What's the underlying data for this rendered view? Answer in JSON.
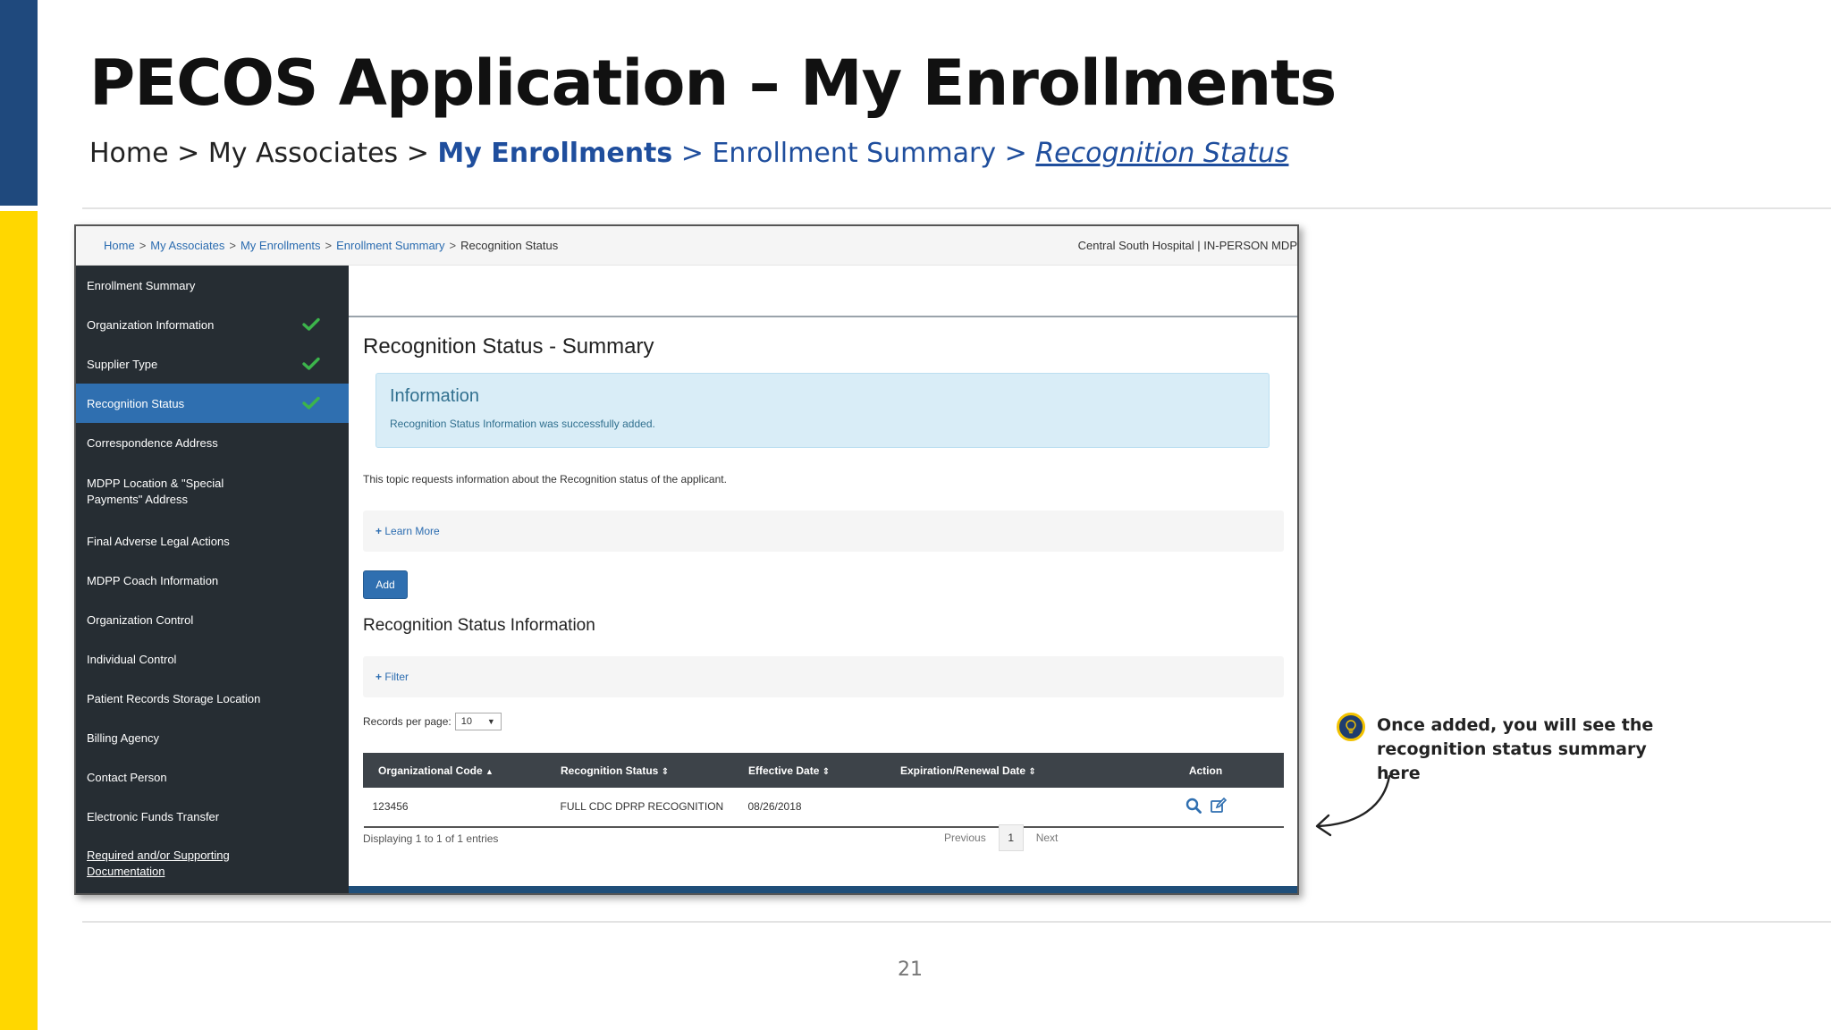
{
  "slide": {
    "title": "PECOS Application – My Enrollments",
    "breadcrumb": {
      "home": "Home",
      "sep": " > ",
      "my_associates": "My Associates",
      "my_enrollments": "My Enrollments",
      "enrollment_summary": "Enrollment Summary",
      "recognition_status": "Recognition Status"
    },
    "callout": "Once added, you will see the recognition status summary here",
    "page_number": "21",
    "colors": {
      "blue_bar": "#1f497d",
      "yellow_bar": "#ffd700"
    }
  },
  "app": {
    "breadcrumb": {
      "home": "Home",
      "my_associates": "My Associates",
      "my_enrollments": "My Enrollments",
      "enrollment_summary": "Enrollment Summary",
      "current": "Recognition Status",
      "sep": ">"
    },
    "facility": "Central South Hospital |  IN-PERSON MDP",
    "sidebar": {
      "items": [
        {
          "label": "Enrollment Summary"
        },
        {
          "label": "Organization Information",
          "check": true
        },
        {
          "label": "Supplier Type",
          "check": true
        },
        {
          "label": "Recognition Status",
          "check": true,
          "active": true
        },
        {
          "label": "Correspondence Address"
        },
        {
          "label": "MDPP Location & \"Special Payments\" Address"
        },
        {
          "label": "Final Adverse Legal Actions"
        },
        {
          "label": "MDPP Coach Information"
        },
        {
          "label": "Organization Control"
        },
        {
          "label": "Individual Control"
        },
        {
          "label": "Patient Records Storage Location"
        },
        {
          "label": "Billing Agency"
        },
        {
          "label": "Contact Person"
        },
        {
          "label": "Electronic Funds Transfer"
        },
        {
          "label": "Required and/or Supporting Documentation"
        }
      ]
    },
    "main": {
      "title": "Recognition Status - Summary",
      "info_title": "Information",
      "info_message": "Recognition Status Information was successfully added.",
      "topic_text": "This topic requests information about the Recognition status of the applicant.",
      "learn_more": "Learn More",
      "add_label": "Add",
      "section_title": "Recognition Status Information",
      "filter_label": "Filter",
      "records_per_page_label": "Records per page:",
      "records_per_page_value": "10",
      "table": {
        "headers": [
          "Organizational Code",
          "Recognition Status",
          "Effective Date",
          "Expiration/Renewal Date",
          "Action"
        ],
        "rows": [
          [
            "123456",
            "FULL CDC DPRP RECOGNITION",
            "08/26/2018",
            ""
          ]
        ]
      },
      "displaying": "Displaying 1 to 1 of 1 entries",
      "pagination": {
        "previous": "Previous",
        "page": "1",
        "next": "Next"
      }
    }
  }
}
